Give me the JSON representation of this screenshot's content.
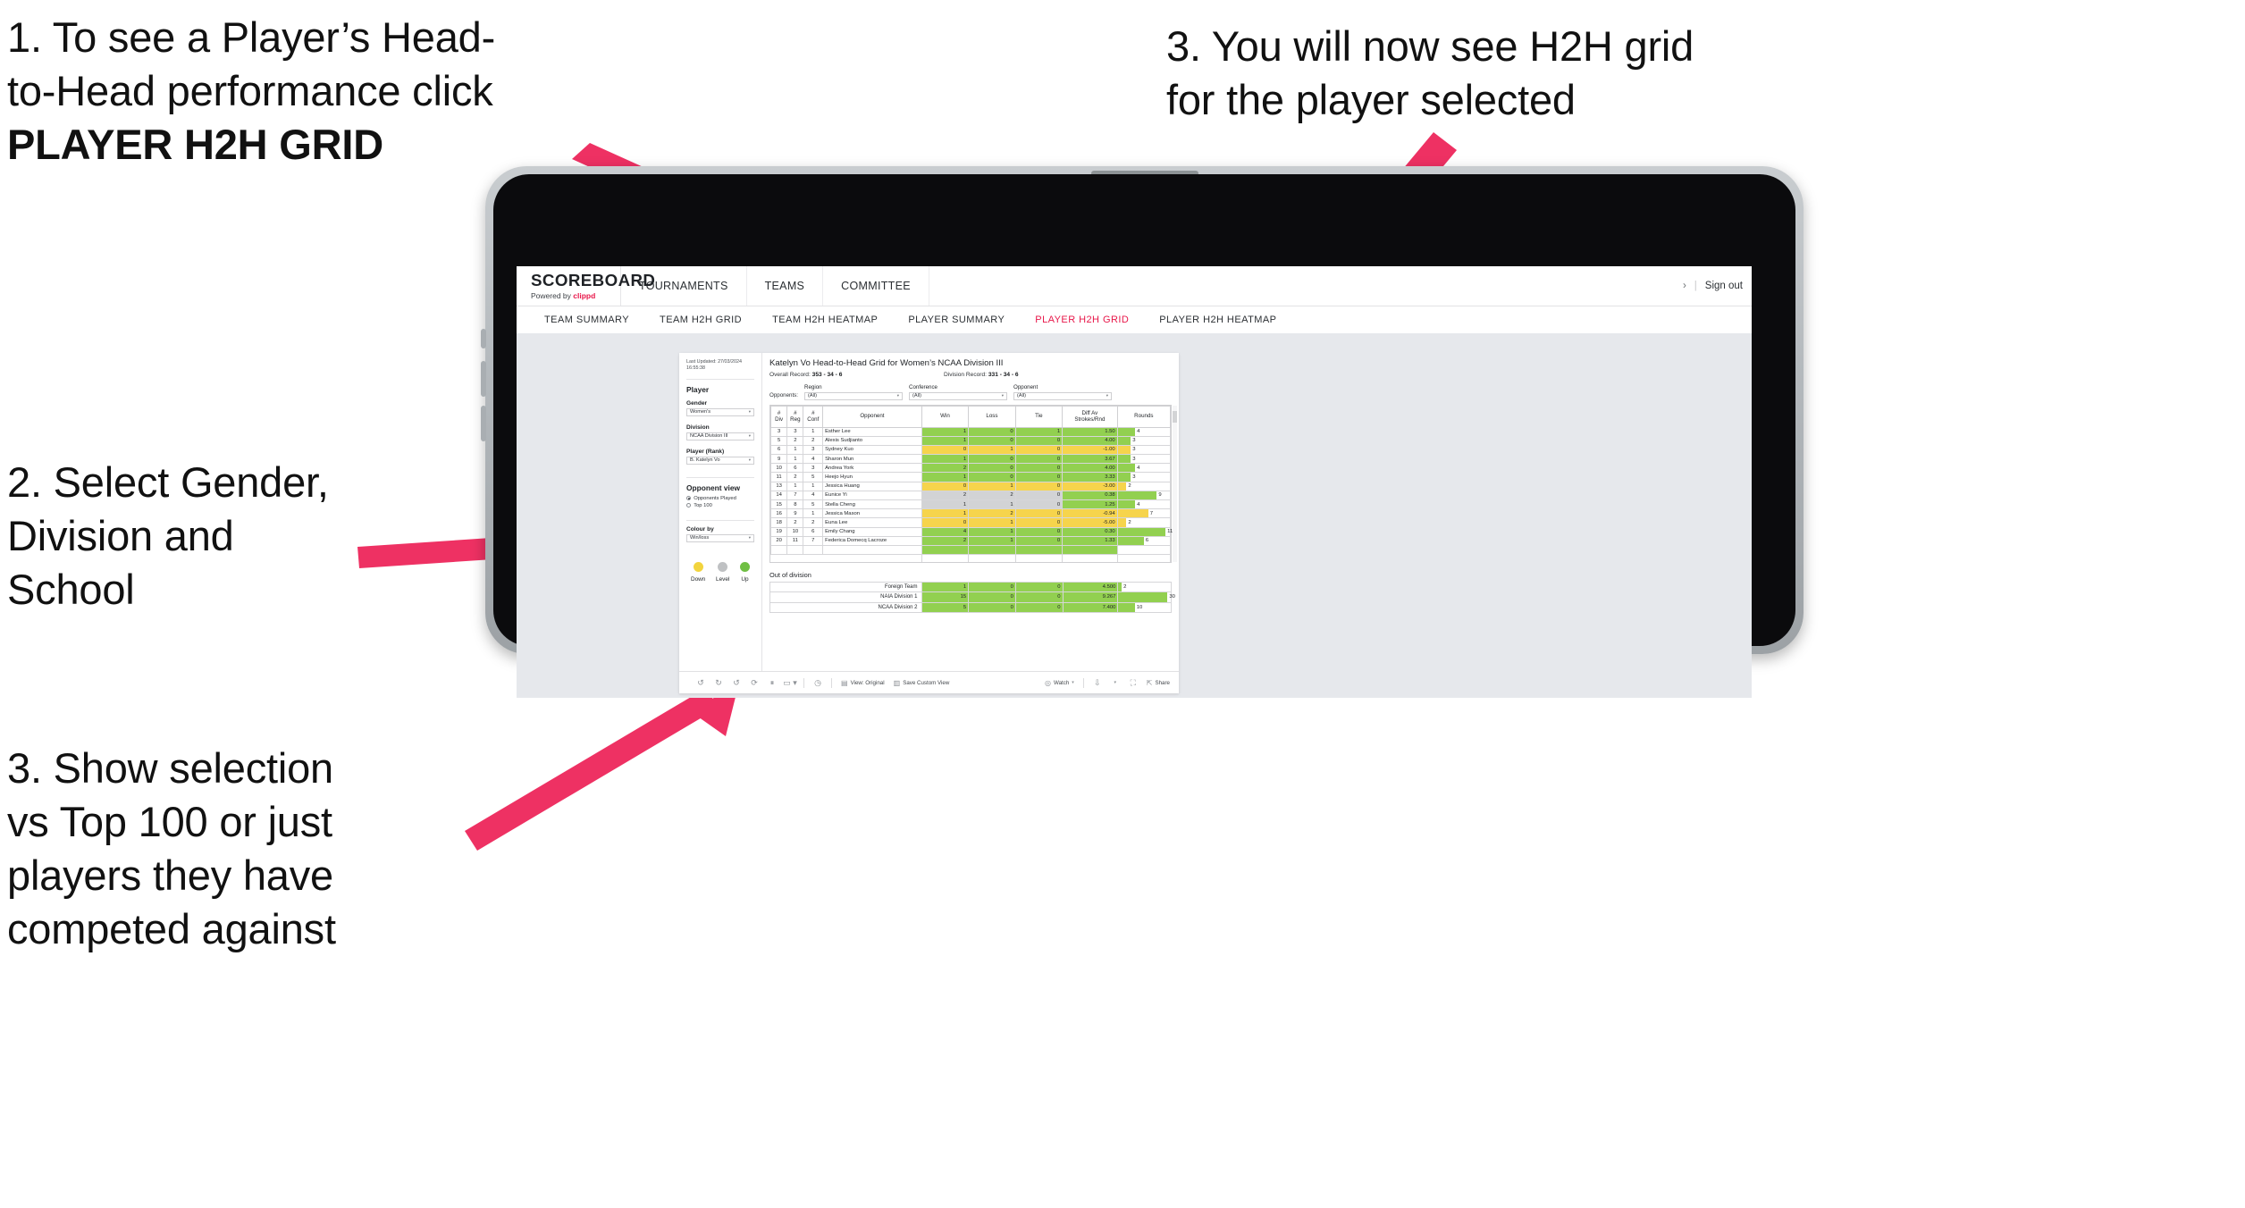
{
  "annotations": {
    "step1_line1": "1. To see a Player’s Head-",
    "step1_line2": "to-Head performance click",
    "step1_bold": "PLAYER H2H GRID",
    "step3_top_line1": "3. You will now see H2H grid",
    "step3_top_line2": "for the player selected",
    "step2_line1": "2. Select Gender,",
    "step2_line2": "Division and",
    "step2_line3": "School",
    "step3_left_line1": "3. Show selection",
    "step3_left_line2": "vs Top 100 or just",
    "step3_left_line3": "players they have",
    "step3_left_line4": "competed against",
    "arrow_color": "#EE3163"
  },
  "app": {
    "logo": "SCOREBOARD",
    "logo_sub_prefix": "Powered by ",
    "logo_sub_brand": "clippd",
    "top_nav": [
      "TOURNAMENTS",
      "TEAMS",
      "COMMITTEE"
    ],
    "sign_out": "Sign out",
    "sub_nav": [
      {
        "label": "TEAM SUMMARY",
        "active": false
      },
      {
        "label": "TEAM H2H GRID",
        "active": false
      },
      {
        "label": "TEAM H2H HEATMAP",
        "active": false
      },
      {
        "label": "PLAYER SUMMARY",
        "active": false
      },
      {
        "label": "PLAYER H2H GRID",
        "active": true
      },
      {
        "label": "PLAYER H2H HEATMAP",
        "active": false
      }
    ],
    "accent_color": "#E8174A"
  },
  "sidebar": {
    "last_updated_line1": "Last Updated: 27/03/2024",
    "last_updated_line2": "16:55:38",
    "player_heading": "Player",
    "gender_label": "Gender",
    "gender_value": "Women's",
    "division_label": "Division",
    "division_value": "NCAA Division III",
    "player_rank_label": "Player (Rank)",
    "player_rank_value": "B. Katelyn Vo",
    "opponent_view_heading": "Opponent view",
    "opponent_view_options": [
      {
        "label": "Opponents Played",
        "selected": true
      },
      {
        "label": "Top 100",
        "selected": false
      }
    ],
    "colour_by_label": "Colour by",
    "colour_by_value": "Win/loss",
    "legend": [
      {
        "label": "Down",
        "color": "#F2D43E"
      },
      {
        "label": "Level",
        "color": "#BFC1C3"
      },
      {
        "label": "Up",
        "color": "#70BF44"
      }
    ]
  },
  "main": {
    "title": "Katelyn Vo Head-to-Head Grid for Women’s NCAA Division III",
    "overall_record_label": "Overall Record:",
    "overall_record_value": "353 - 34 - 6",
    "division_record_label": "Division Record:",
    "division_record_value": "331 - 34 - 6",
    "opponents_label": "Opponents:",
    "filters": [
      {
        "label": "Region",
        "value": "(All)"
      },
      {
        "label": "Conference",
        "value": "(All)"
      },
      {
        "label": "Opponent",
        "value": "(All)"
      }
    ],
    "out_of_division_title": "Out of division"
  },
  "chart_data": {
    "type": "table",
    "title": "Katelyn Vo Head-to-Head Grid for Women’s NCAA Division III",
    "columns": [
      "# Div",
      "# Reg",
      "# Conf",
      "Opponent",
      "Win",
      "Loss",
      "Tie",
      "Diff Av Strokes/Rnd",
      "Rounds"
    ],
    "column_header_lines": [
      [
        "#",
        "Div"
      ],
      [
        "#",
        "Reg"
      ],
      [
        "#",
        "Conf"
      ],
      [
        "Opponent"
      ],
      [
        "Win"
      ],
      [
        "Loss"
      ],
      [
        "Tie"
      ],
      [
        "Diff Av",
        "Strokes/Rnd"
      ],
      [
        "Rounds"
      ]
    ],
    "rounds_max": 12,
    "rows": [
      {
        "div": "3",
        "reg": "3",
        "conf": "1",
        "opponent": "Esther Lee",
        "win": "1",
        "loss": "0",
        "tie": "1",
        "diff": "1.50",
        "rounds": "4",
        "color": "g"
      },
      {
        "div": "5",
        "reg": "2",
        "conf": "2",
        "opponent": "Alexis Sudjianto",
        "win": "1",
        "loss": "0",
        "tie": "0",
        "diff": "4.00",
        "rounds": "3",
        "color": "g"
      },
      {
        "div": "6",
        "reg": "1",
        "conf": "3",
        "opponent": "Sydney Kuo",
        "win": "0",
        "loss": "1",
        "tie": "0",
        "diff": "-1.00",
        "rounds": "3",
        "color": "y"
      },
      {
        "div": "9",
        "reg": "1",
        "conf": "4",
        "opponent": "Sharon Mun",
        "win": "1",
        "loss": "0",
        "tie": "0",
        "diff": "3.67",
        "rounds": "3",
        "color": "g"
      },
      {
        "div": "10",
        "reg": "6",
        "conf": "3",
        "opponent": "Andrea York",
        "win": "2",
        "loss": "0",
        "tie": "0",
        "diff": "4.00",
        "rounds": "4",
        "color": "g"
      },
      {
        "div": "11",
        "reg": "2",
        "conf": "5",
        "opponent": "Heejo Hyun",
        "win": "1",
        "loss": "0",
        "tie": "0",
        "diff": "3.33",
        "rounds": "3",
        "color": "g"
      },
      {
        "div": "13",
        "reg": "1",
        "conf": "1",
        "opponent": "Jessica Huang",
        "win": "0",
        "loss": "1",
        "tie": "0",
        "diff": "-3.00",
        "rounds": "2",
        "color": "y"
      },
      {
        "div": "14",
        "reg": "7",
        "conf": "4",
        "opponent": "Eunice Yi",
        "win": "2",
        "loss": "2",
        "tie": "0",
        "diff": "0.38",
        "rounds": "9",
        "color": "gr",
        "diff_color": "g"
      },
      {
        "div": "15",
        "reg": "8",
        "conf": "5",
        "opponent": "Stella Cheng",
        "win": "1",
        "loss": "1",
        "tie": "0",
        "diff": "1.25",
        "rounds": "4",
        "color": "gr",
        "diff_color": "g"
      },
      {
        "div": "16",
        "reg": "9",
        "conf": "1",
        "opponent": "Jessica Mason",
        "win": "1",
        "loss": "2",
        "tie": "0",
        "diff": "-0.94",
        "rounds": "7",
        "color": "y"
      },
      {
        "div": "18",
        "reg": "2",
        "conf": "2",
        "opponent": "Euna Lee",
        "win": "0",
        "loss": "1",
        "tie": "0",
        "diff": "-5.00",
        "rounds": "2",
        "color": "y"
      },
      {
        "div": "19",
        "reg": "10",
        "conf": "6",
        "opponent": "Emily Chang",
        "win": "4",
        "loss": "1",
        "tie": "0",
        "diff": "0.30",
        "rounds": "11",
        "color": "g"
      },
      {
        "div": "20",
        "reg": "11",
        "conf": "7",
        "opponent": "Federica Domecq Lacroze",
        "win": "2",
        "loss": "1",
        "tie": "0",
        "diff": "1.33",
        "rounds": "6",
        "color": "g"
      }
    ],
    "out_of_division": {
      "rounds_max": 32,
      "rows": [
        {
          "label": "Foreign Team",
          "win": "1",
          "loss": "0",
          "tie": "0",
          "diff": "4.500",
          "rounds": "2",
          "color": "g"
        },
        {
          "label": "NAIA Division 1",
          "win": "15",
          "loss": "0",
          "tie": "0",
          "diff": "9.267",
          "rounds": "30",
          "color": "g"
        },
        {
          "label": "NCAA Division 2",
          "win": "5",
          "loss": "0",
          "tie": "0",
          "diff": "7.400",
          "rounds": "10",
          "color": "g"
        }
      ]
    }
  },
  "toolbar": {
    "view_label": "View: Original",
    "save_label": "Save Custom View",
    "watch_label": "Watch",
    "share_label": "Share"
  }
}
